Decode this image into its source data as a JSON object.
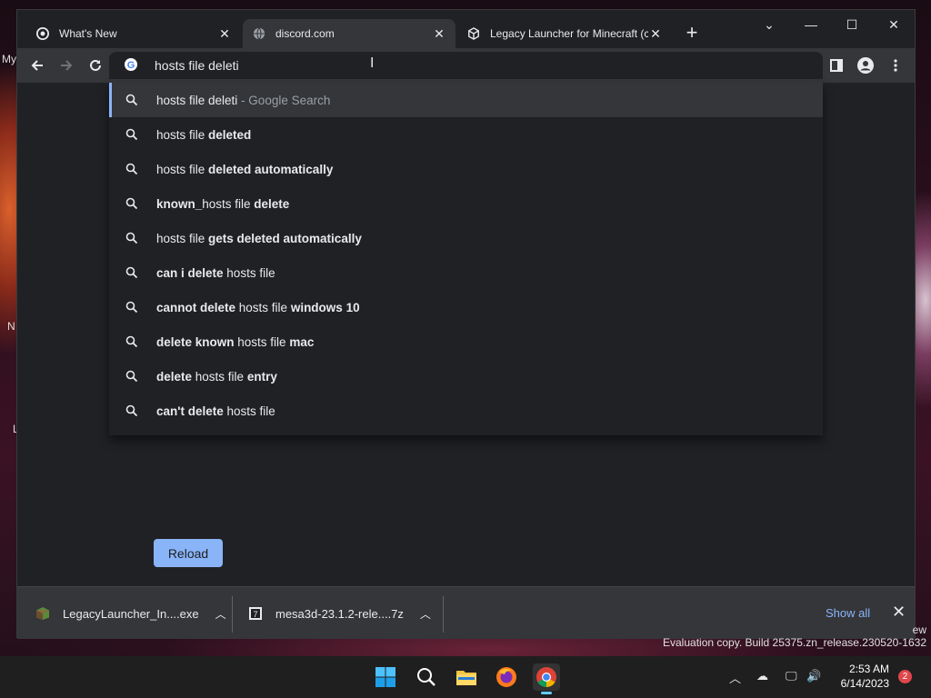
{
  "desktop": {
    "side_text": [
      "My",
      "N",
      "L"
    ]
  },
  "tabs": [
    {
      "title": "What's New",
      "icon": "chrome-icon",
      "active": false
    },
    {
      "title": "discord.com",
      "icon": "globe-icon",
      "active": true
    },
    {
      "title": "Legacy Launcher for Minecraft (c",
      "icon": "cube-icon",
      "active": false
    }
  ],
  "omnibox": {
    "query": "hosts file deleti"
  },
  "suggestions": [
    {
      "parts": [
        {
          "t": "hosts file deleti",
          "b": false
        },
        {
          "t": " - Google Search",
          "b": false,
          "sub": true
        }
      ],
      "selected": true
    },
    {
      "parts": [
        {
          "t": "hosts file ",
          "b": false
        },
        {
          "t": "deleted",
          "b": true
        }
      ]
    },
    {
      "parts": [
        {
          "t": "hosts file ",
          "b": false
        },
        {
          "t": "deleted automatically",
          "b": true
        }
      ]
    },
    {
      "parts": [
        {
          "t": "known_",
          "b": true
        },
        {
          "t": "hosts file ",
          "b": false
        },
        {
          "t": "delete",
          "b": true
        }
      ]
    },
    {
      "parts": [
        {
          "t": "hosts file ",
          "b": false
        },
        {
          "t": "gets deleted automatically",
          "b": true
        }
      ]
    },
    {
      "parts": [
        {
          "t": "can i delete ",
          "b": true
        },
        {
          "t": "hosts file",
          "b": false
        }
      ]
    },
    {
      "parts": [
        {
          "t": "cannot delete ",
          "b": true
        },
        {
          "t": "hosts file ",
          "b": false
        },
        {
          "t": "windows 10",
          "b": true
        }
      ]
    },
    {
      "parts": [
        {
          "t": "delete known ",
          "b": true
        },
        {
          "t": "hosts file ",
          "b": false
        },
        {
          "t": "mac",
          "b": true
        }
      ]
    },
    {
      "parts": [
        {
          "t": "delete ",
          "b": true
        },
        {
          "t": "hosts file ",
          "b": false
        },
        {
          "t": "entry",
          "b": true
        }
      ]
    },
    {
      "parts": [
        {
          "t": "can't delete ",
          "b": true
        },
        {
          "t": "hosts file",
          "b": false
        }
      ]
    }
  ],
  "page": {
    "reload_label": "Reload"
  },
  "downloads": {
    "items": [
      {
        "name": "LegacyLauncher_In....exe",
        "icon": "minecraft-block-icon"
      },
      {
        "name": "mesa3d-23.1.2-rele....7z",
        "icon": "archive-icon"
      }
    ],
    "show_all": "Show all"
  },
  "watermark": {
    "suffix": "ew",
    "text": "Evaluation copy. Build 25375.zn_release.230520-1632"
  },
  "taskbar": {
    "time": "2:53 AM",
    "date": "6/14/2023",
    "notifications": "2"
  },
  "colors": {
    "accent": "#8ab4f8",
    "window_bg": "#202124",
    "toolbar_bg": "#35363a"
  }
}
